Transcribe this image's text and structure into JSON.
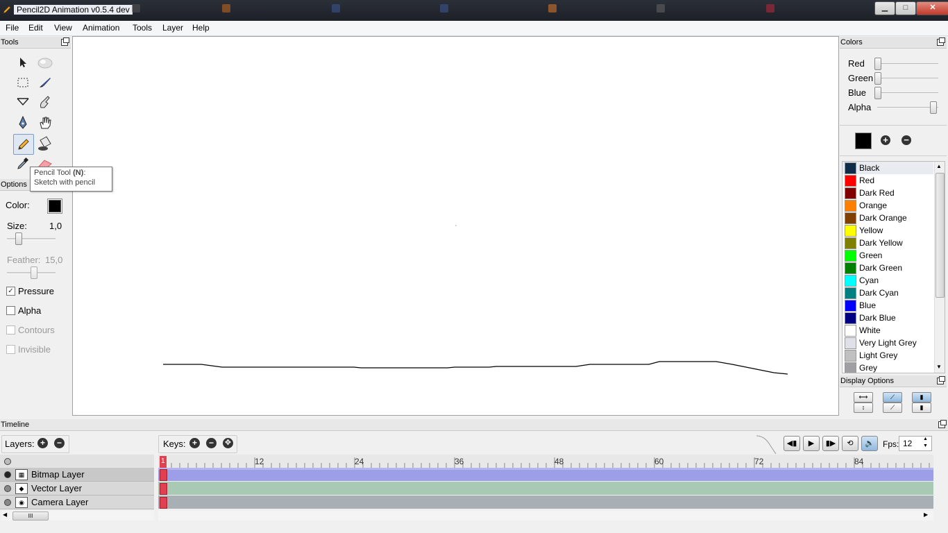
{
  "window": {
    "title": "Pencil2D Animation v0.5.4 dev",
    "minimize": "▁",
    "maximize": "□",
    "close": "✕"
  },
  "taskbar_ghosts": [
    "",
    "",
    "",
    "",
    "",
    "",
    ""
  ],
  "menu": [
    "File",
    "Edit",
    "View",
    "Animation",
    "Tools",
    "Layer",
    "Help"
  ],
  "tools_panel": {
    "title": "Tools",
    "tooltip": {
      "title": "Pencil Tool ",
      "shortcut": "(N)",
      "suffix": ":",
      "description": "Sketch with pencil"
    }
  },
  "options_panel": {
    "title": "Options",
    "color_label": "Color:",
    "color_value": "#000000",
    "size_label": "Size:",
    "size_value": "1,0",
    "size_fraction": 0.2,
    "feather_label": "Feather:",
    "feather_value": "15,0",
    "feather_fraction": 0.55,
    "checkboxes": [
      {
        "label": "Pressure",
        "checked": true,
        "enabled": true
      },
      {
        "label": "Alpha",
        "checked": false,
        "enabled": true
      },
      {
        "label": "Contours",
        "checked": false,
        "enabled": false
      },
      {
        "label": "Invisible",
        "checked": false,
        "enabled": false
      }
    ]
  },
  "colors_panel": {
    "title": "Colors",
    "sliders": [
      {
        "label": "Red",
        "fraction": 0.0
      },
      {
        "label": "Green",
        "fraction": 0.0
      },
      {
        "label": "Blue",
        "fraction": 0.0
      },
      {
        "label": "Alpha",
        "fraction": 1.0
      }
    ],
    "current_color": "#000000",
    "add_symbol": "+",
    "remove_symbol": "−",
    "palette": [
      {
        "name": "Black",
        "color": "#0f2c48"
      },
      {
        "name": "Red",
        "color": "#ff0000"
      },
      {
        "name": "Dark Red",
        "color": "#800000"
      },
      {
        "name": "Orange",
        "color": "#ff8000"
      },
      {
        "name": "Dark Orange",
        "color": "#804000"
      },
      {
        "name": "Yellow",
        "color": "#ffff00"
      },
      {
        "name": "Dark Yellow",
        "color": "#808000"
      },
      {
        "name": "Green",
        "color": "#00ff00"
      },
      {
        "name": "Dark Green",
        "color": "#008000"
      },
      {
        "name": "Cyan",
        "color": "#00ffff"
      },
      {
        "name": "Dark Cyan",
        "color": "#008080"
      },
      {
        "name": "Blue",
        "color": "#0000ff"
      },
      {
        "name": "Dark Blue",
        "color": "#000080"
      },
      {
        "name": "White",
        "color": "#ffffff"
      },
      {
        "name": "Very Light Grey",
        "color": "#e0e0e8"
      },
      {
        "name": "Light Grey",
        "color": "#c0c0c0"
      },
      {
        "name": "Grey",
        "color": "#a0a0a4"
      }
    ],
    "selected_index": 0
  },
  "display_options": {
    "title": "Display Options"
  },
  "timeline": {
    "title": "Timeline",
    "layers_label": "Layers:",
    "keys_label": "Keys:",
    "fps_label": "Fps:",
    "fps_value": "12",
    "ruler_labels": [
      "1",
      "12",
      "24",
      "36",
      "48",
      "60",
      "72",
      "84"
    ],
    "layers": [
      {
        "name": "Bitmap Layer",
        "icon": "bitmap-layer-icon",
        "color": "#9d9ee8",
        "active": true
      },
      {
        "name": "Vector Layer",
        "icon": "vector-layer-icon",
        "color": "#a8c9b3",
        "active": false
      },
      {
        "name": "Camera Layer",
        "icon": "camera-layer-icon",
        "color": "#a8b0b5",
        "active": false
      }
    ],
    "scroll_grip": "III"
  }
}
